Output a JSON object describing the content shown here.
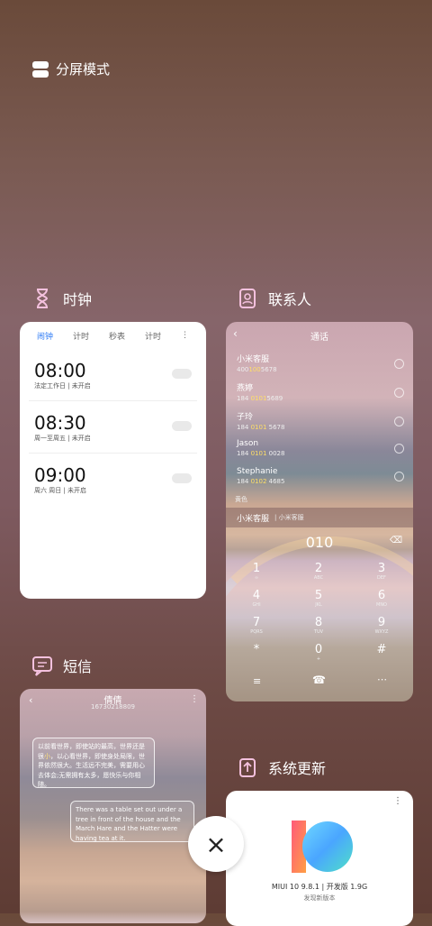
{
  "split_mode": {
    "label": "分屏模式"
  },
  "apps": {
    "clock": {
      "title": "时钟",
      "tabs": [
        "闹钟",
        "计时",
        "秒表",
        "计时"
      ],
      "alarms": [
        {
          "time": "08:00",
          "desc": "法定工作日 | 未开启"
        },
        {
          "time": "08:30",
          "desc": "周一至周五 | 未开启"
        },
        {
          "time": "09:00",
          "desc": "周六 周日 | 未开启"
        }
      ]
    },
    "contacts": {
      "title": "联系人",
      "screen_title": "通话",
      "rows": [
        {
          "name": "小米客服",
          "pre": "400",
          "hl": "100",
          "post": "5678"
        },
        {
          "name": "燕婷",
          "pre": "184 ",
          "hl": "0101",
          "post": "5689"
        },
        {
          "name": "子玲",
          "pre": "184 ",
          "hl": "0101",
          "post": " 5678"
        },
        {
          "name": "Jason",
          "pre": "184 ",
          "hl": "0101",
          "post": " 0028"
        },
        {
          "name": "Stephanie",
          "pre": "184 ",
          "hl": "0102",
          "post": " 4685"
        }
      ],
      "hint": "黄色",
      "service_bar": "小米客服",
      "service_sub": "| 小米客服",
      "dial_number": "010",
      "keys": [
        {
          "n": "1",
          "l": "∞"
        },
        {
          "n": "2",
          "l": "ABC"
        },
        {
          "n": "3",
          "l": "DEF"
        },
        {
          "n": "4",
          "l": "GHI"
        },
        {
          "n": "5",
          "l": "JKL"
        },
        {
          "n": "6",
          "l": "MNO"
        },
        {
          "n": "7",
          "l": "PQRS"
        },
        {
          "n": "8",
          "l": "TUV"
        },
        {
          "n": "9",
          "l": "WXYZ"
        },
        {
          "n": "*",
          "l": ""
        },
        {
          "n": "0",
          "l": "+"
        },
        {
          "n": "#",
          "l": ""
        }
      ]
    },
    "messages": {
      "title": "短信",
      "contact": "倩倩",
      "number": "16730218809",
      "bubble_zh_pre": "以前看世界，即使站的最高，世界还是很",
      "bubble_zh_hl": "小",
      "bubble_zh_post": "，以心看世界，即使身处局限，世界依然很大。生活远不完美，需要用心去体会;无需拥有太多，愿快乐与你相随。",
      "bubble_en": "There was a table set out under a tree in front of the house and the March Hare and the Hatter were having tea at it."
    },
    "update": {
      "title": "系统更新",
      "version": "MIUI 10 9.8.1 | 开发版 1.9G",
      "new_version": "发现新版本"
    }
  },
  "close_button": {
    "label": "×"
  },
  "colors": {
    "accent": "#2f7bf5",
    "highlight": "#ffdf66"
  }
}
